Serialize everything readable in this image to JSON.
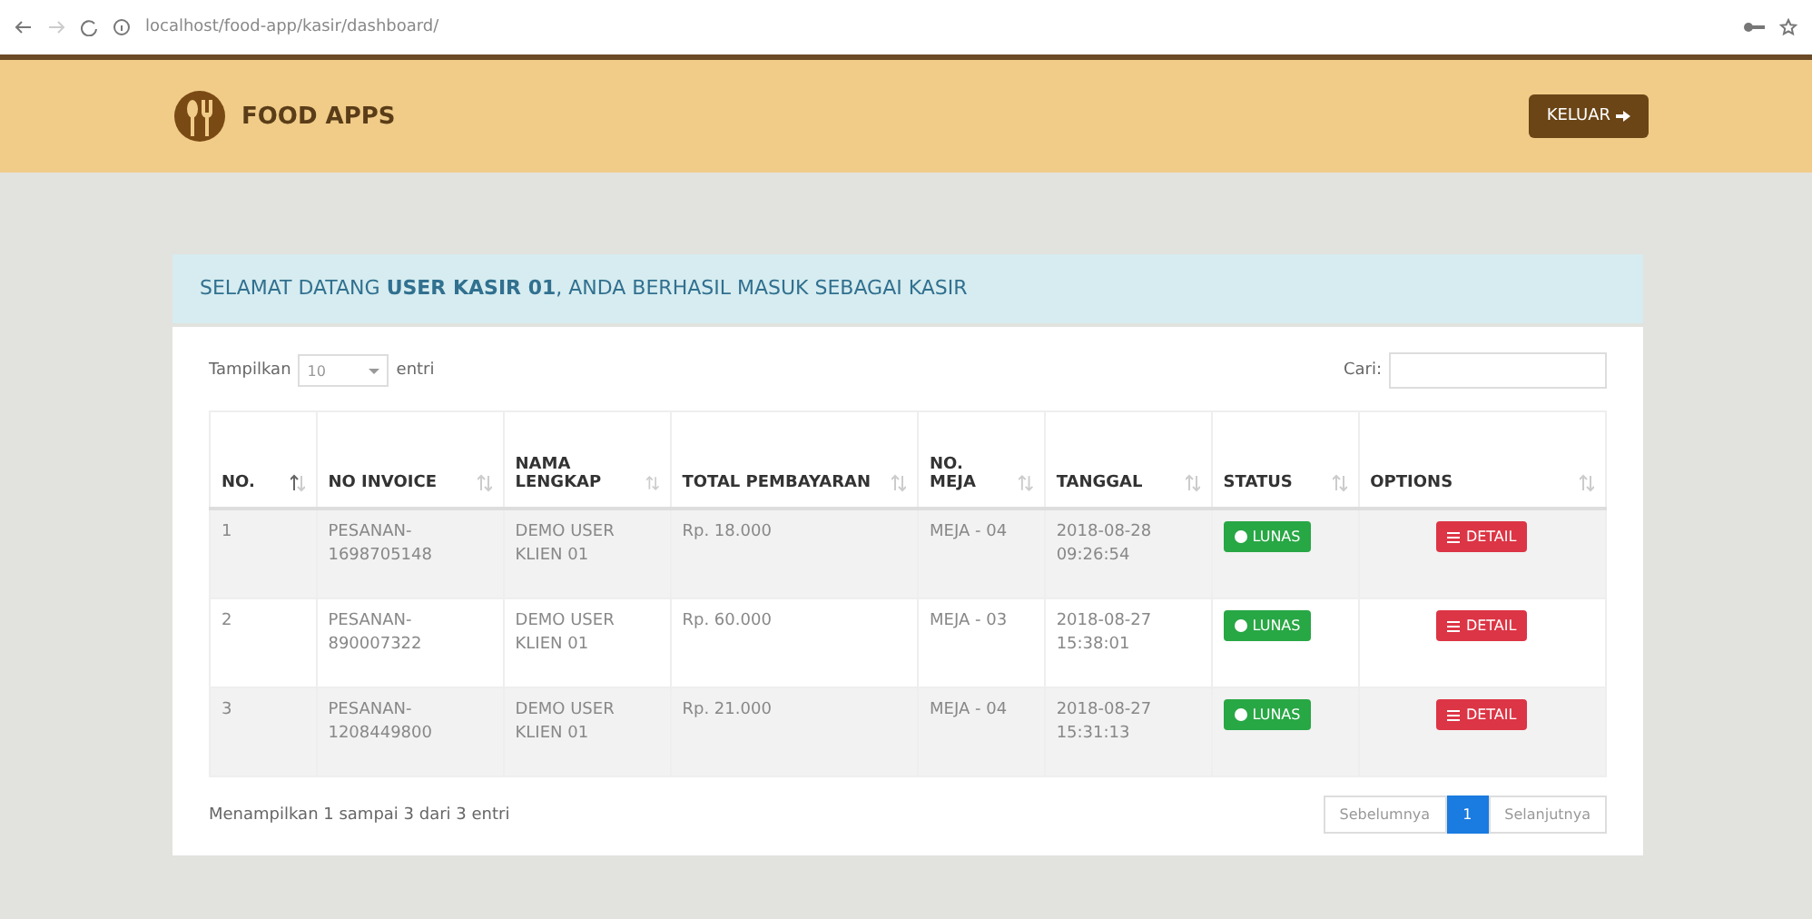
{
  "browser": {
    "url": "localhost/food-app/kasir/dashboard/"
  },
  "header": {
    "brand": "FOOD APPS",
    "logout": "KELUAR"
  },
  "alert": "SELAMAT DATANG **USER KASIR 01**, ANDA BERHASIL MASUK SEBAGAI KASIR",
  "length": {
    "prefix": "Tampilkan",
    "value": "10",
    "suffix": "entri"
  },
  "search": {
    "label": "Cari:"
  },
  "table": {
    "columns": [
      {
        "label": "NO.",
        "sorted": true
      },
      {
        "label": "NO INVOICE",
        "sorted": false
      },
      {
        "label": "NAMA LENGKAP",
        "sorted": false
      },
      {
        "label": "TOTAL PEMBAYARAN",
        "sorted": false
      },
      {
        "label": "NO. MEJA",
        "sorted": false
      },
      {
        "label": "TANGGAL",
        "sorted": false
      },
      {
        "label": "STATUS",
        "sorted": false
      },
      {
        "label": "OPTIONS",
        "sorted": false
      }
    ],
    "rows": [
      {
        "no": "1",
        "invoice": "PESANAN-1698705148",
        "nama": "DEMO USER KLIEN 01",
        "total": "Rp. 18.000",
        "meja": "MEJA - 04",
        "tanggal": "2018-08-28 09:26:54",
        "status": "LUNAS",
        "action": "DETAIL"
      },
      {
        "no": "2",
        "invoice": "PESANAN-890007322",
        "nama": "DEMO USER KLIEN 01",
        "total": "Rp. 60.000",
        "meja": "MEJA - 03",
        "tanggal": "2018-08-27 15:38:01",
        "status": "LUNAS",
        "action": "DETAIL"
      },
      {
        "no": "3",
        "invoice": "PESANAN-1208449800",
        "nama": "DEMO USER KLIEN 01",
        "total": "Rp. 21.000",
        "meja": "MEJA - 04",
        "tanggal": "2018-08-27 15:31:13",
        "status": "LUNAS",
        "action": "DETAIL"
      }
    ]
  },
  "info": "Menampilkan 1 sampai 3 dari 3 entri",
  "pagination": [
    {
      "label": "Sebelumnya",
      "selected": false
    },
    {
      "label": "1",
      "selected": true
    },
    {
      "label": "Selanjutnya",
      "selected": false
    }
  ]
}
